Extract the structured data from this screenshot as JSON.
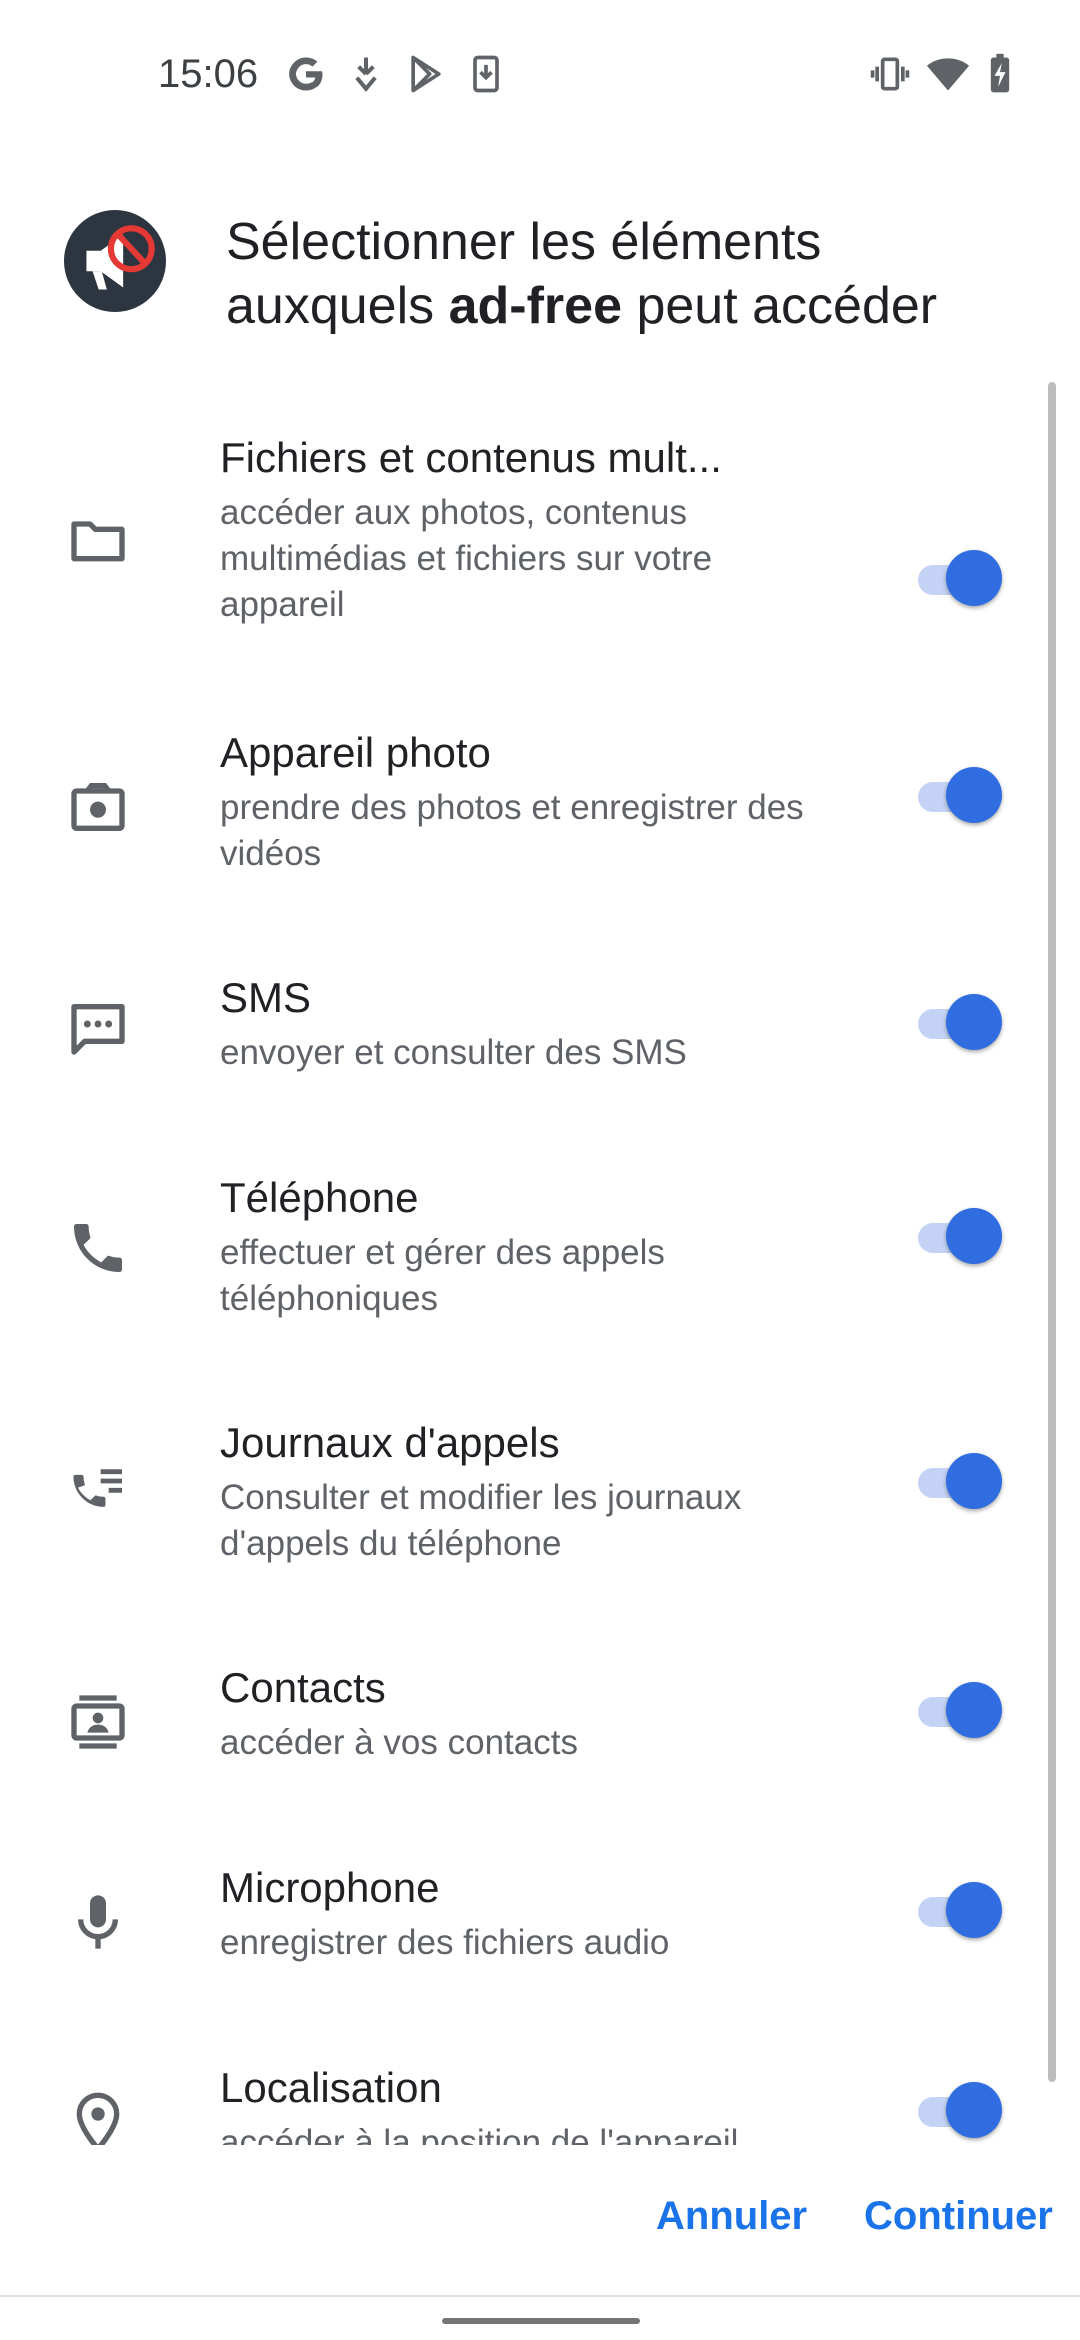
{
  "status_bar": {
    "time": "15:06",
    "left_icons": [
      "google-g-icon",
      "download-arrow-icon",
      "play-store-icon",
      "download-box-icon"
    ],
    "right_icons": [
      "vibrate-icon",
      "wifi-icon",
      "battery-charging-icon"
    ]
  },
  "header": {
    "title_line1": "Sélectionner les éléments",
    "title_line2_prefix": "auxquels ",
    "title_app_name": "ad-free",
    "title_line2_suffix": " peut accéder",
    "app_icon": "ad-free-app-icon"
  },
  "permissions": [
    {
      "title": "Fichiers et contenus mult...",
      "subtitle": "accéder aux photos, contenus multimédias et fichiers sur votre appareil",
      "icon": "folder-icon",
      "enabled": true
    },
    {
      "title": "Appareil photo",
      "subtitle": "prendre des photos et enregistrer des vidéos",
      "icon": "camera-icon",
      "enabled": true
    },
    {
      "title": "SMS",
      "subtitle": "envoyer et consulter des SMS",
      "icon": "sms-icon",
      "enabled": true
    },
    {
      "title": "Téléphone",
      "subtitle": "effectuer et gérer des appels téléphoniques",
      "icon": "phone-icon",
      "enabled": true
    },
    {
      "title": "Journaux d'appels",
      "subtitle": "Consulter et modifier les journaux d'appels du téléphone",
      "icon": "call-log-icon",
      "enabled": true
    },
    {
      "title": "Contacts",
      "subtitle": "accéder à vos contacts",
      "icon": "contacts-icon",
      "enabled": true
    },
    {
      "title": "Microphone",
      "subtitle": "enregistrer des fichiers audio",
      "icon": "microphone-icon",
      "enabled": true
    },
    {
      "title": "Localisation",
      "subtitle": "accéder à la position de l'appareil",
      "icon": "location-icon",
      "enabled": true
    }
  ],
  "footer": {
    "cancel_label": "Annuler",
    "continue_label": "Continuer"
  },
  "colors": {
    "accent": "#1a73e8",
    "toggle_thumb": "#2f6de0",
    "toggle_track": "#c4d3f5"
  }
}
